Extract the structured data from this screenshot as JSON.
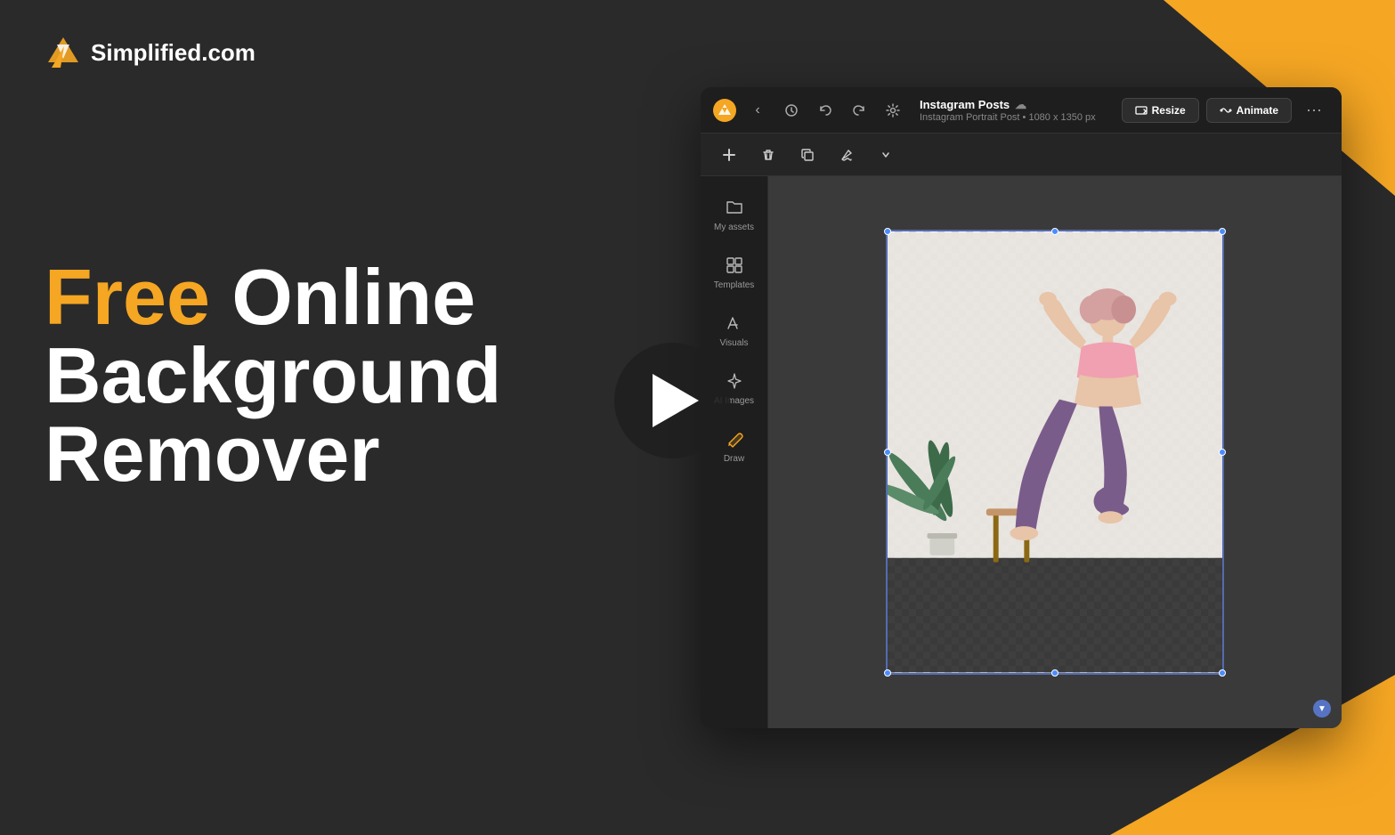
{
  "brand": {
    "name": "Simplified.com",
    "logo_symbol": "⚡"
  },
  "headline": {
    "line1_free": "Free",
    "line1_online": " Online",
    "line2": "Background",
    "line3": "Remover"
  },
  "editor": {
    "header": {
      "title": "Instagram Posts",
      "subtitle": "Instagram Portrait Post • 1080 x 1350 px",
      "back_button": "‹",
      "history_icon": "🕐",
      "undo_icon": "↩",
      "redo_icon": "↪",
      "settings_icon": "⚙"
    },
    "toolbar": {
      "add_icon": "+",
      "delete_icon": "🗑",
      "copy_icon": "⧉",
      "fill_icon": "🪣",
      "more_icon": "…",
      "resize_label": "Resize",
      "animate_label": "Animate",
      "more_actions": "···"
    },
    "sidebar": {
      "items": [
        {
          "id": "my-assets",
          "label": "My assets",
          "icon": "folder"
        },
        {
          "id": "templates",
          "label": "Templates",
          "icon": "grid"
        },
        {
          "id": "visuals",
          "label": "Visuals",
          "icon": "text-a"
        },
        {
          "id": "ai-images",
          "label": "AI Images",
          "icon": "sparkle"
        },
        {
          "id": "draw",
          "label": "Draw",
          "icon": "pencil"
        }
      ]
    },
    "canvas": {
      "image_description": "Yoga person with transparent background",
      "dimensions": "1080 x 1350"
    }
  },
  "decorations": {
    "triangle_top_right": "orange accent top right",
    "triangle_bottom_right": "orange accent bottom right"
  }
}
